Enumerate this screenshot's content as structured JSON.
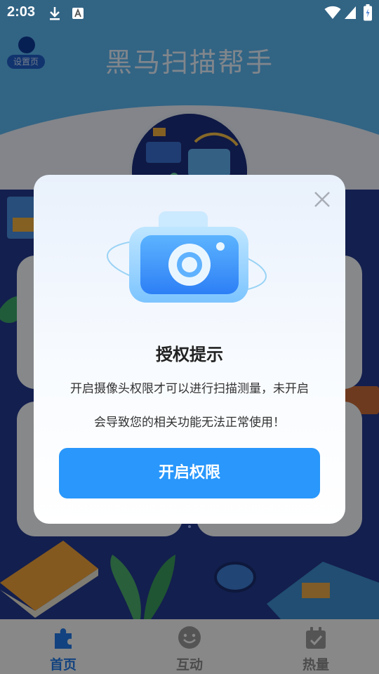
{
  "status_bar": {
    "time": "2:03",
    "icons": [
      "download-icon",
      "font-a-icon",
      "wifi-icon",
      "signal-icon",
      "battery-charging-icon"
    ]
  },
  "header": {
    "title": "黑马扫描帮手",
    "settings_label": "设置页"
  },
  "dialog": {
    "title": "授权提示",
    "message_line1": "开启摄像头权限才可以进行扫描测量，未开启",
    "message_line2": "会导致您的相关功能无法正常使用！",
    "button_label": "开启权限",
    "close_icon": "close-icon",
    "illustration": "camera-icon"
  },
  "bottom_nav": {
    "items": [
      {
        "label": "首页",
        "icon": "puzzle-icon",
        "active": true
      },
      {
        "label": "互动",
        "icon": "smiley-icon",
        "active": false
      },
      {
        "label": "热量",
        "icon": "calendar-check-icon",
        "active": false
      }
    ]
  },
  "colors": {
    "primary": "#2997fb",
    "nav_active": "#2179e8",
    "header_bg": "#5cb7f0",
    "scene_bg": "#243a8f"
  }
}
